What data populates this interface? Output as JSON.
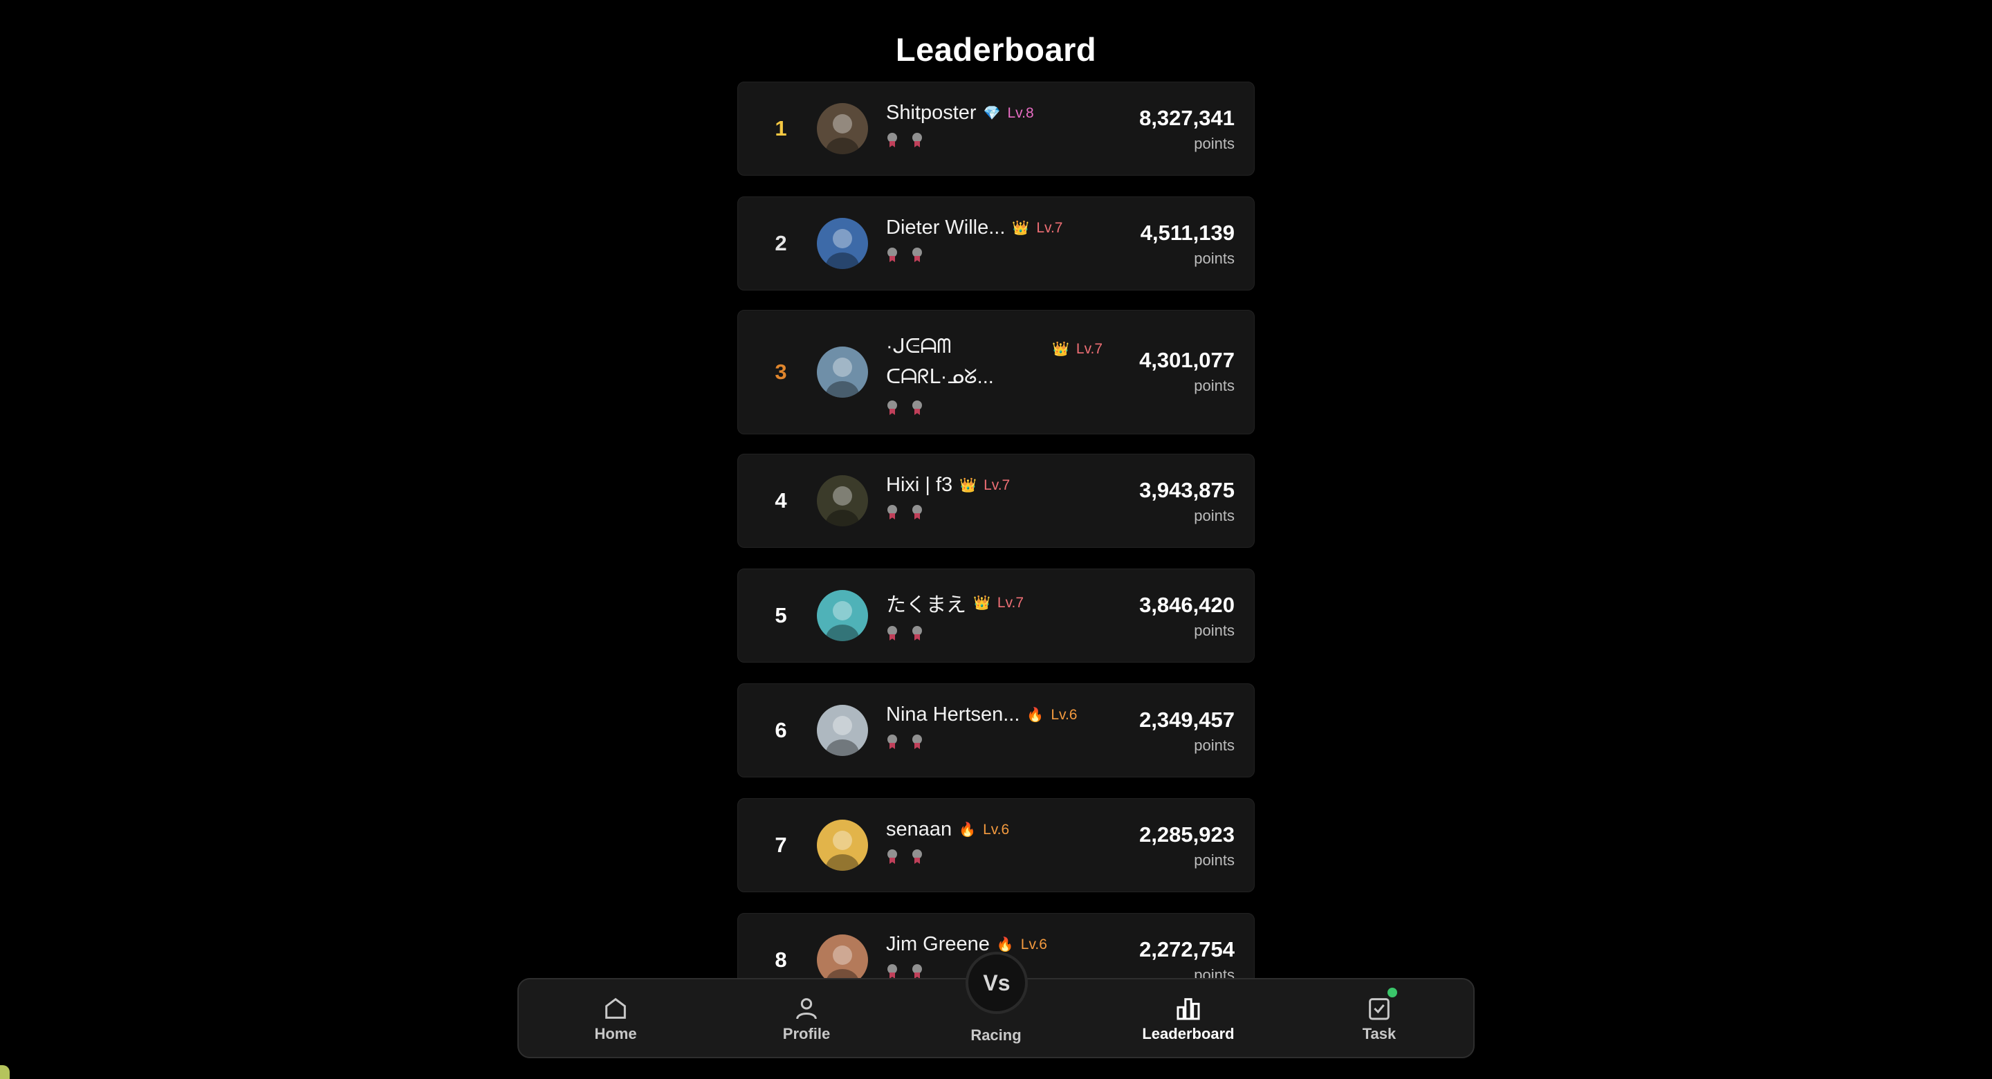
{
  "page": {
    "title": "Leaderboard"
  },
  "entries": [
    {
      "rank": "1",
      "rank_color": "#f5c842",
      "name": "Shitposter",
      "level_icon": "diamond-icon",
      "level": "Lv.8",
      "level_color": "#e86dc4",
      "points": "8,327,341",
      "points_label": "points"
    },
    {
      "rank": "2",
      "rank_color": "#e6e6e6",
      "name": "Dieter Wille...",
      "level_icon": "crown-icon",
      "level": "Lv.7",
      "level_color": "#ef6f75",
      "points": "4,511,139",
      "points_label": "points"
    },
    {
      "rank": "3",
      "rank_color": "#e0862d",
      "name": "·ᒍᕮᗩᗰ ᑕᗩᖇᒪ·ᓄᘜ...",
      "level_icon": "crown-icon",
      "level": "Lv.7",
      "level_color": "#ef6f75",
      "points": "4,301,077",
      "points_label": "points"
    },
    {
      "rank": "4",
      "rank_color": "#ffffff",
      "name": "Hixi | f3",
      "level_icon": "crown-icon",
      "level": "Lv.7",
      "level_color": "#ef6f75",
      "points": "3,943,875",
      "points_label": "points"
    },
    {
      "rank": "5",
      "rank_color": "#ffffff",
      "name": "たくまえ",
      "level_icon": "crown-icon",
      "level": "Lv.7",
      "level_color": "#ef6f75",
      "points": "3,846,420",
      "points_label": "points"
    },
    {
      "rank": "6",
      "rank_color": "#ffffff",
      "name": "Nina Hertsen...",
      "level_icon": "fire-icon",
      "level": "Lv.6",
      "level_color": "#f39a3f",
      "points": "2,349,457",
      "points_label": "points"
    },
    {
      "rank": "7",
      "rank_color": "#ffffff",
      "name": "senaan",
      "level_icon": "fire-icon",
      "level": "Lv.6",
      "level_color": "#f39a3f",
      "points": "2,285,923",
      "points_label": "points"
    },
    {
      "rank": "8",
      "rank_color": "#ffffff",
      "name": "Jim Greene",
      "level_icon": "fire-icon",
      "level": "Lv.6",
      "level_color": "#f39a3f",
      "points": "2,272,754",
      "points_label": "points"
    }
  ],
  "nav": {
    "home": "Home",
    "profile": "Profile",
    "racing": "Racing",
    "racing_badge": "Vs",
    "leaderboard": "Leaderboard",
    "task": "Task",
    "active": "leaderboard",
    "task_dot_color": "#3ac66a"
  }
}
